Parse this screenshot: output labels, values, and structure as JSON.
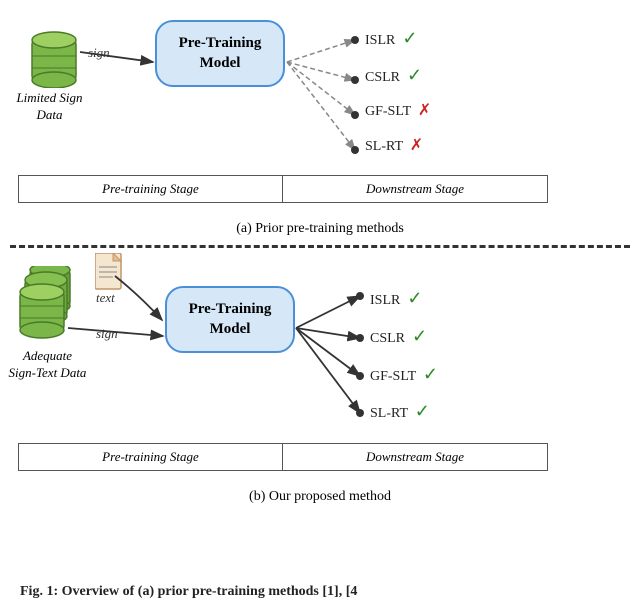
{
  "top_diagram": {
    "title": "Prior pre-training methods",
    "caption": "(a) Prior pre-training methods",
    "model_label_line1": "Pre-Training",
    "model_label_line2": "Model",
    "db_label": "Limited\nSign Data",
    "sign_label": "sign",
    "stage_left": "Pre-training Stage",
    "stage_right": "Downstream Stage",
    "tasks": [
      {
        "name": "ISLR",
        "result": "check"
      },
      {
        "name": "CSLR",
        "result": "check"
      },
      {
        "name": "GF-SLT",
        "result": "cross"
      },
      {
        "name": "SL-RT",
        "result": "cross"
      }
    ]
  },
  "bottom_diagram": {
    "title": "Our proposed method",
    "caption": "(b) Our proposed method",
    "model_label_line1": "Pre-Training",
    "model_label_line2": "Model",
    "db_label": "Adequate\nSign-Text Data",
    "sign_label": "sign",
    "text_label": "text",
    "stage_left": "Pre-training Stage",
    "stage_right": "Downstream Stage",
    "tasks": [
      {
        "name": "ISLR",
        "result": "check"
      },
      {
        "name": "CSLR",
        "result": "check"
      },
      {
        "name": "GF-SLT",
        "result": "check"
      },
      {
        "name": "SL-RT",
        "result": "check"
      }
    ]
  },
  "fig_caption": {
    "prefix": "Fig. 1: Overview of (a) ",
    "bold1": "prior pre-training methods",
    "mid": " [1], [4",
    "suffix": ""
  }
}
